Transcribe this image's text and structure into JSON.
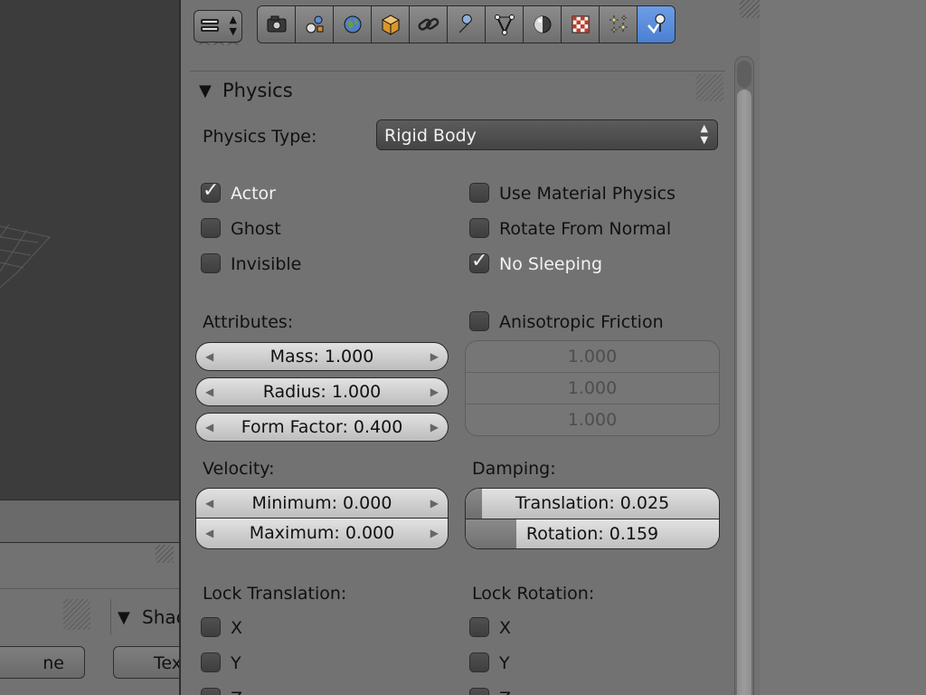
{
  "left_panel": {
    "shading_header": "Shad",
    "button_left": "ne",
    "button_right": "Tex"
  },
  "toolbar": {
    "editor_icon": "properties-editor-icon",
    "tabs": [
      {
        "name": "render",
        "icon": "camera-icon",
        "active": false
      },
      {
        "name": "scene",
        "icon": "scene-icon",
        "active": false
      },
      {
        "name": "world",
        "icon": "globe-icon",
        "active": false
      },
      {
        "name": "object",
        "icon": "cube-icon",
        "active": false
      },
      {
        "name": "constraints",
        "icon": "chain-link-icon",
        "active": false
      },
      {
        "name": "modifiers",
        "icon": "wrench-icon",
        "active": false
      },
      {
        "name": "object-data",
        "icon": "vertex-icon",
        "active": false
      },
      {
        "name": "material",
        "icon": "material-sphere-icon",
        "active": false
      },
      {
        "name": "texture",
        "icon": "checker-texture-icon",
        "active": false
      },
      {
        "name": "particles",
        "icon": "particles-icon",
        "active": false
      },
      {
        "name": "physics",
        "icon": "physics-icon",
        "active": true
      }
    ],
    "active_color": "#5b8cdb"
  },
  "physics": {
    "header": "Physics",
    "type_label": "Physics Type:",
    "type_value": "Rigid Body",
    "checkboxes_left": [
      {
        "label": "Actor",
        "checked": true
      },
      {
        "label": "Ghost",
        "checked": false
      },
      {
        "label": "Invisible",
        "checked": false
      }
    ],
    "checkboxes_right": [
      {
        "label": "Use Material Physics",
        "checked": false
      },
      {
        "label": "Rotate From Normal",
        "checked": false
      },
      {
        "label": "No Sleeping",
        "checked": true
      }
    ],
    "attributes_label": "Attributes:",
    "mass": "Mass: 1.000",
    "radius": "Radius: 1.000",
    "form_factor": "Form Factor: 0.400",
    "anisotropic_label": "Anisotropic Friction",
    "anisotropic_checked": false,
    "anisotropic_values": [
      "1.000",
      "1.000",
      "1.000"
    ],
    "velocity_label": "Velocity:",
    "velocity_min": "Minimum: 0.000",
    "velocity_max": "Maximum: 0.000",
    "damping_label": "Damping:",
    "damping_translation": "Translation: 0.025",
    "damping_rotation": "Rotation: 0.159",
    "damping_translation_value": 0.025,
    "damping_rotation_value": 0.159,
    "lock_translation_label": "Lock Translation:",
    "lock_rotation_label": "Lock Rotation:",
    "lock_translation": [
      {
        "label": "X",
        "checked": false
      },
      {
        "label": "Y",
        "checked": false
      },
      {
        "label": "Z",
        "checked": false
      }
    ],
    "lock_rotation": [
      {
        "label": "X",
        "checked": false
      },
      {
        "label": "Y",
        "checked": false
      },
      {
        "label": "Z",
        "checked": false
      }
    ]
  }
}
